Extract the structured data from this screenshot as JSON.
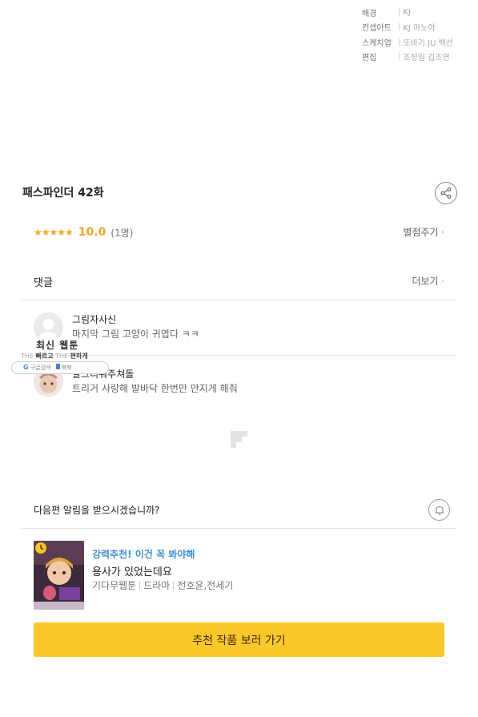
{
  "credits": [
    {
      "role": "",
      "names": ""
    },
    {
      "role": "배경",
      "names": "KJ"
    },
    {
      "role": "컨셉아트",
      "names": "KJ    마노아"
    },
    {
      "role": "스케치업",
      "names": "또바기  JU  백선"
    },
    {
      "role": "편집",
      "names": "조성림  김조연"
    }
  ],
  "episode": {
    "title": "패스파인더 42화"
  },
  "rating": {
    "stars": "★★★★★",
    "score": "10.0",
    "count": "(1명)",
    "rate_label": "별점주기"
  },
  "comments": {
    "heading": "댓글",
    "more_label": "더보기",
    "items": [
      {
        "name": "그림자사신",
        "text": "마지막 그림 고양이 귀엽다 ㅋㅋ"
      },
      {
        "name": "날그리워주쳐돌",
        "text": "트리거 사랑해 발바닥 한번만 만지게 해줘"
      }
    ]
  },
  "ad": {
    "title": "최신 웹툰",
    "sub1_faint": "THE",
    "sub1": "빠르고",
    "sub2_faint": "THE",
    "sub2": "편하게",
    "google_label": "구글검색",
    "bookmark_label": "북북"
  },
  "notify": {
    "question": "다음편 알림을 받으시겠습니까?"
  },
  "recommend": {
    "tag": "강력추천! 이건 꼭 봐야해",
    "title": "용사가 있었는데요",
    "platform": "기다무웹툰",
    "genre": "드라마",
    "authors": "전호윤,전세기",
    "cta": "추천 작품 보러 가기"
  },
  "colors": {
    "accent_yellow": "#fcc729",
    "star_orange": "#f5a623",
    "tag_blue": "#3b8fd6"
  },
  "icons": {
    "share": "share-icon",
    "bell": "bell-icon",
    "chevron": "chevron-right-icon",
    "wait_free": "clock-icon"
  }
}
